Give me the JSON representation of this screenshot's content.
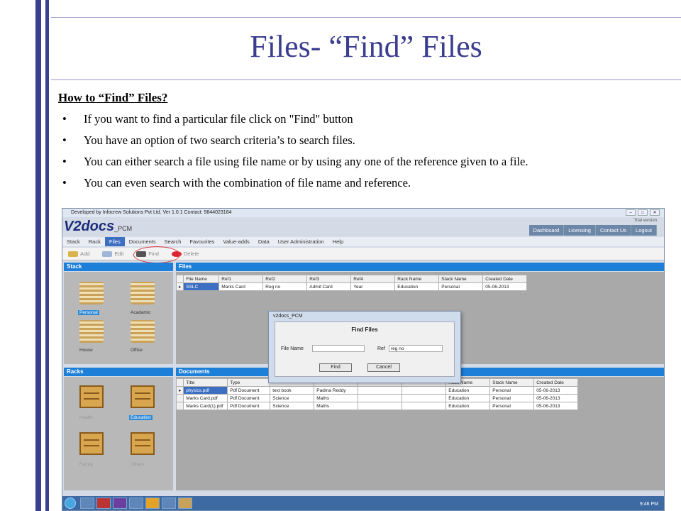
{
  "slide": {
    "title": "Files- “Find” Files",
    "heading": "How to “Find” Files?",
    "bullets": [
      "If you want to find a particular file click on \"Find\" button",
      "You have an option of two search criteria’s to search files.",
      "You can either search a file using file name or by using any one of the reference given to a file.",
      "You can even search with the combination of file name and reference."
    ]
  },
  "app": {
    "window_title": "Developed by Infocrew Solutions Pvt Ltd. Ver 1.0.1 Contact: 9844023184",
    "trial": "Trial version",
    "logo": "V2docs",
    "logo_suffix": "_PCM",
    "nav": [
      "Dashboard",
      "Licensing",
      "Contact Us",
      "Logout"
    ],
    "menu": [
      "Stack",
      "Rack",
      "Files",
      "Documents",
      "Search",
      "Favourites",
      "Value-adds",
      "Data",
      "User Administration",
      "Help"
    ],
    "toolbar": {
      "add": "Add",
      "edit": "Edit",
      "find": "Find",
      "delete": "Delete"
    },
    "stack_header": "Stack",
    "stacks": [
      "Personal",
      "Acadamic",
      "House",
      "Office"
    ],
    "racks_header": "Racks",
    "racks": [
      "Health",
      "Education",
      "Family",
      "Others"
    ],
    "files_header": "Files",
    "files_columns": [
      "File Name",
      "Ref1",
      "Ref2",
      "Ref3",
      "Ref4",
      "Rack Name",
      "Stack Name",
      "Created Date"
    ],
    "files_rows": [
      [
        "SSLC",
        "Marks Card",
        "Reg no",
        "Admit Card",
        "Year",
        "Education",
        "Personal",
        "05-06-2013"
      ]
    ],
    "documents_header": "Documents",
    "documents_columns_left": [
      "Title",
      "Type"
    ],
    "documents_columns_right": [
      "Rack Name",
      "Stack Name",
      "Created Date"
    ],
    "documents_rows": [
      [
        "physics.pdf",
        "Pdf Document",
        "text book",
        "Padma Reddy",
        "",
        "",
        "Education",
        "Personal",
        "05-06-2013"
      ],
      [
        "Marks Card.pdf",
        "Pdf Document",
        "Science",
        "Maths",
        "",
        "",
        "Education",
        "Personal",
        "05-06-2013"
      ],
      [
        "Marks Card(1).pdf",
        "Pdf Document",
        "Science",
        "Maths",
        "",
        "",
        "Education",
        "Personal",
        "05-06-2013"
      ]
    ],
    "dialog": {
      "window_title": "v2docs_PCM",
      "heading": "Find Files",
      "file_name_label": "File Name",
      "file_name_value": "",
      "ref_label": "Ref",
      "ref_value": "reg no",
      "find": "Find",
      "cancel": "Cancel"
    },
    "clock": "9:46 PM"
  }
}
